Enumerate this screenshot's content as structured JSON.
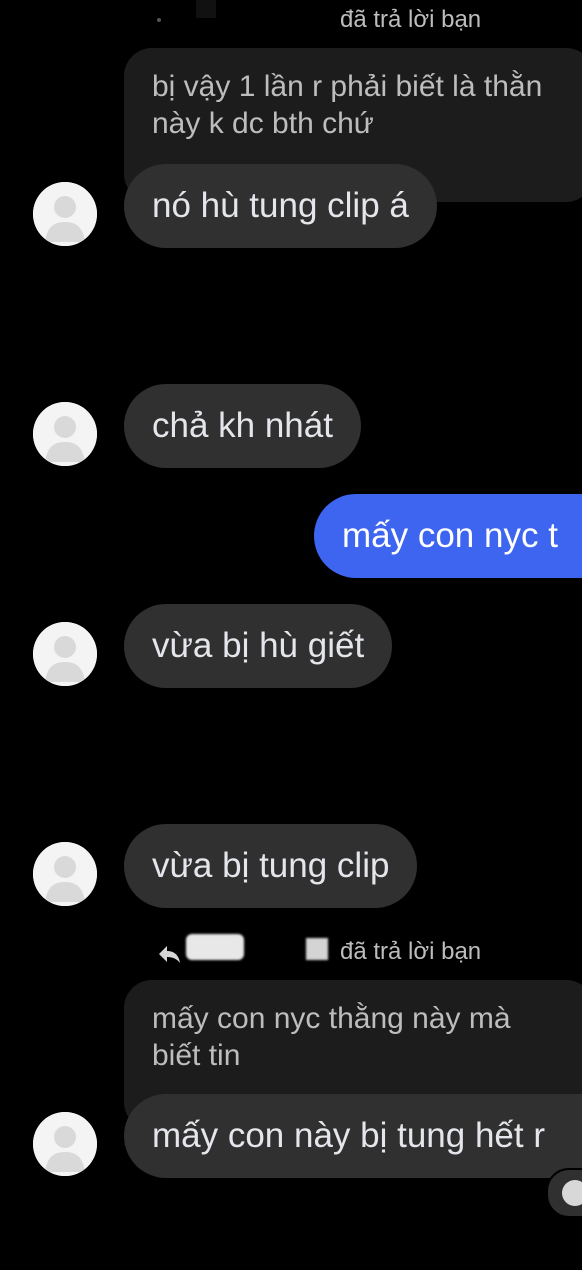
{
  "reply_label_top": "đã trả lời bạn",
  "reply_label_bottom": "đã trả lời bạn",
  "messages": {
    "replied_1": "bị vậy 1 lần r phải biết là thằn\nnày k dc bth chứ",
    "msg_1": "nó hù tung clip á",
    "msg_2": "chả kh nhát",
    "sent_1": "mấy con nyc t",
    "msg_3": "vừa bị hù giết",
    "msg_4": "vừa bị tung clip",
    "replied_2": "mấy con nyc thằng này mà\nbiết tin",
    "msg_5": "mấy con này bị tung hết r"
  },
  "colors": {
    "background": "#000000",
    "incoming_bubble": "#303030",
    "outgoing_bubble": "#3d65f0",
    "reply_bubble": "#1c1c1c"
  }
}
